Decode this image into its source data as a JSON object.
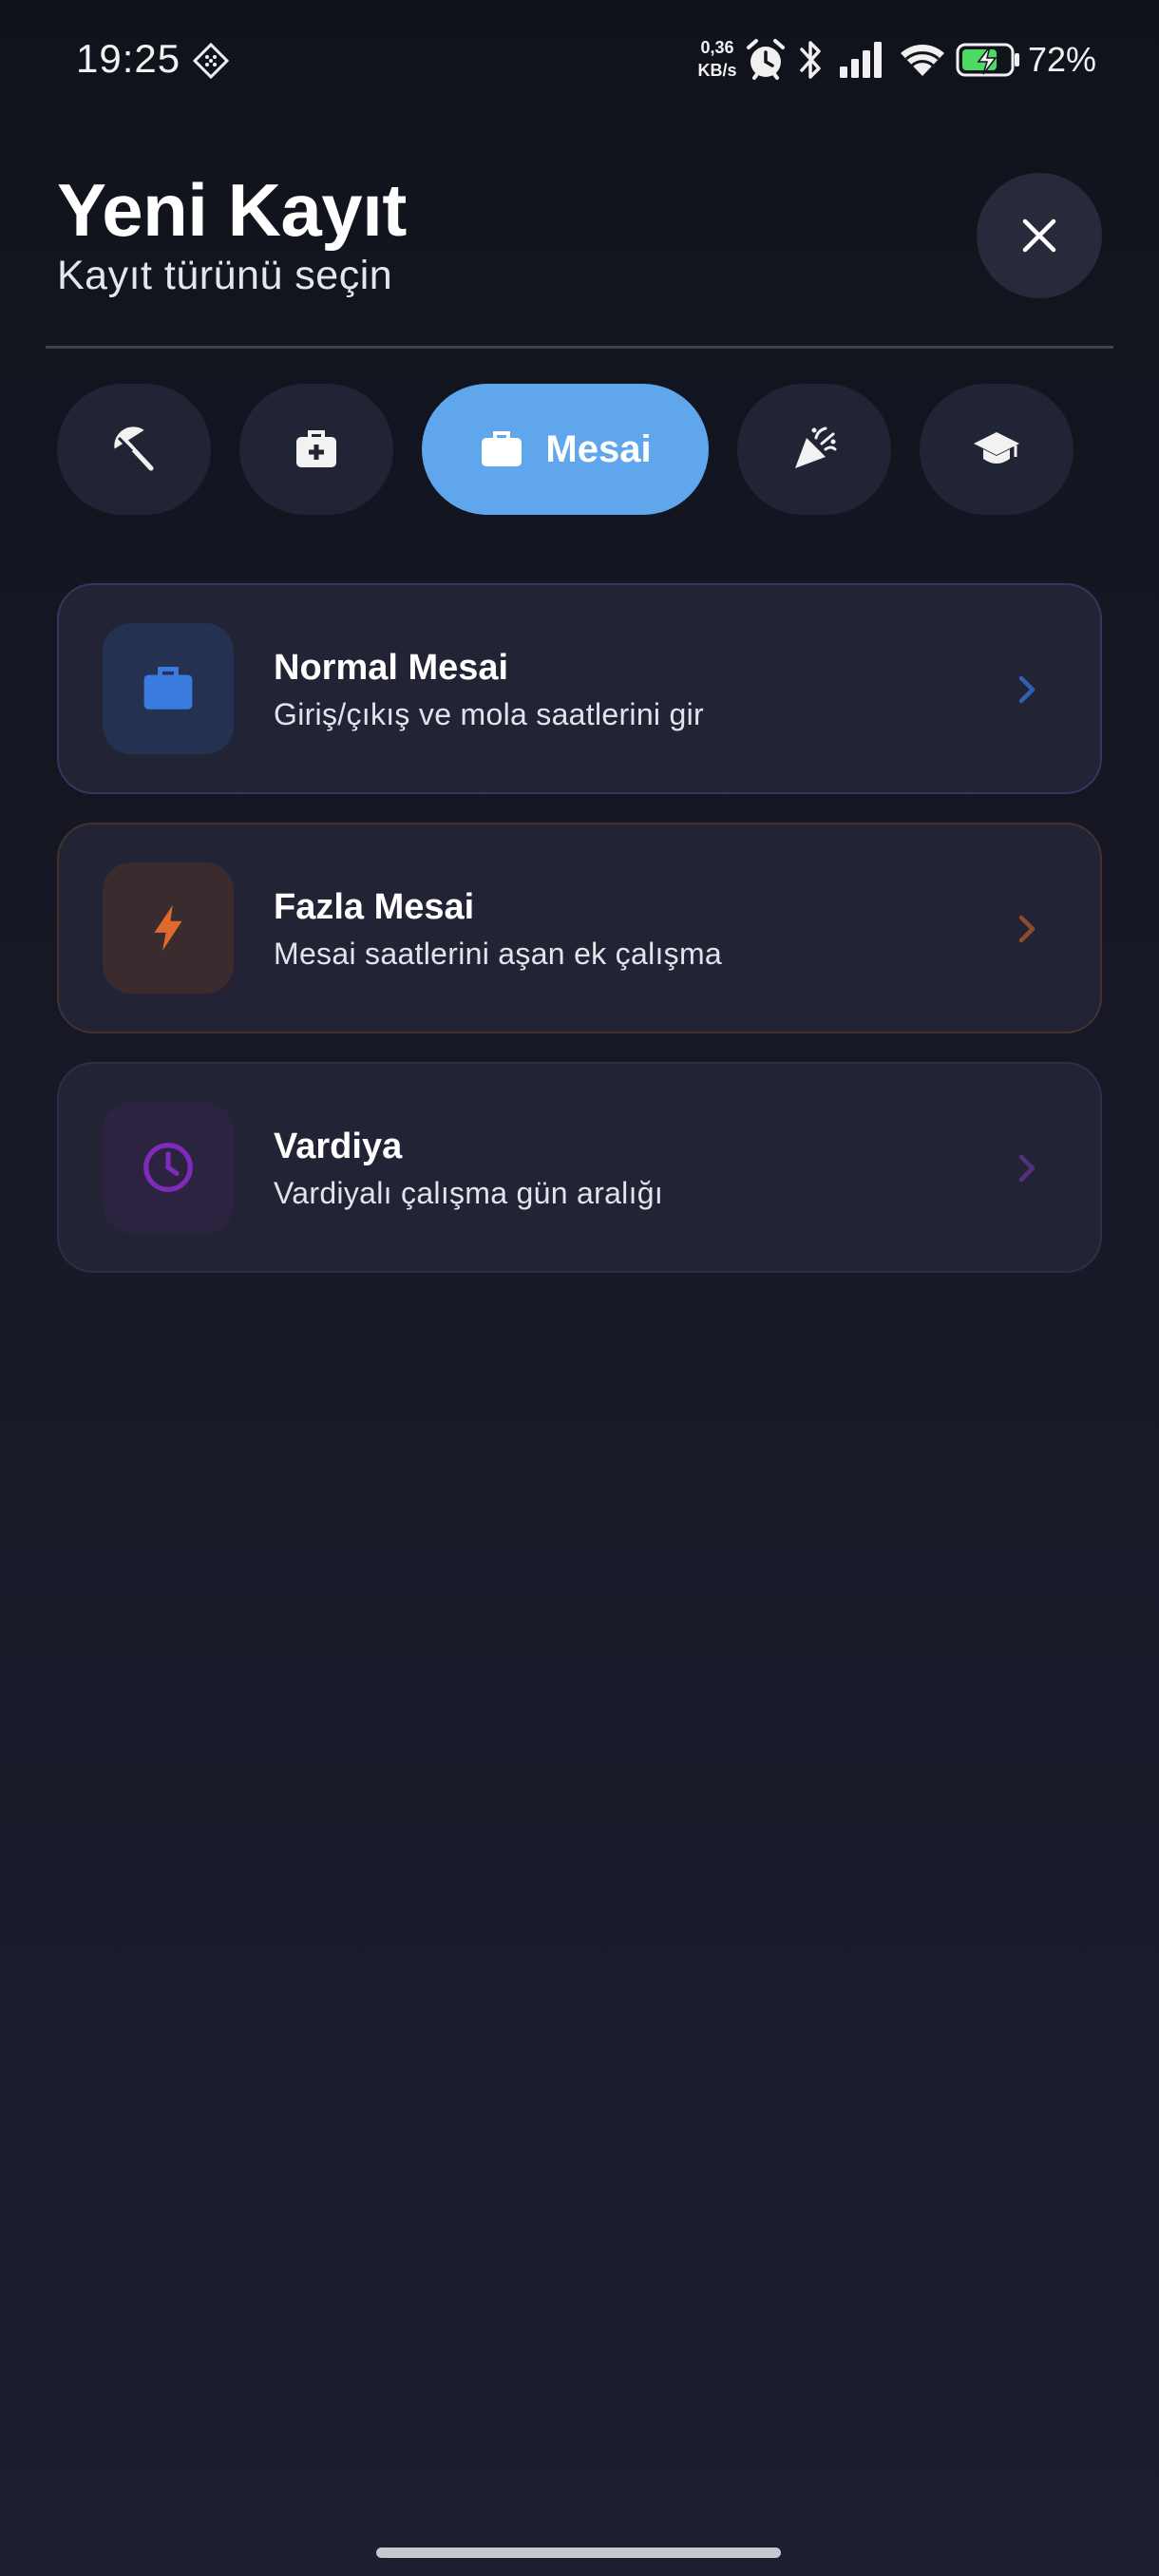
{
  "status_bar": {
    "time": "19:25",
    "network_speed_value": "0,36",
    "network_speed_unit": "KB/s",
    "battery_percent": "72%",
    "icons": [
      "grid-icon",
      "alarm-icon",
      "bluetooth-icon",
      "signal-icon",
      "wifi-icon",
      "battery-charging-icon"
    ]
  },
  "header": {
    "title": "Yeni Kayıt",
    "subtitle": "Kayıt türünü seçin",
    "close_icon": "close-icon"
  },
  "categories": [
    {
      "icon": "beach-umbrella-icon",
      "label": "",
      "active": false
    },
    {
      "icon": "medical-bag-icon",
      "label": "",
      "active": false
    },
    {
      "icon": "briefcase-icon",
      "label": "Mesai",
      "active": true
    },
    {
      "icon": "party-popper-icon",
      "label": "",
      "active": false
    },
    {
      "icon": "graduation-cap-icon",
      "label": "",
      "active": false
    }
  ],
  "options": [
    {
      "title": "Normal Mesai",
      "description": "Giriş/çıkış ve mola saatlerini gir",
      "icon": "briefcase-icon",
      "accent": "#3a7be0"
    },
    {
      "title": "Fazla Mesai",
      "description": "Mesai saatlerini aşan ek çalışma",
      "icon": "bolt-icon",
      "accent": "#e06a2e"
    },
    {
      "title": "Vardiya",
      "description": "Vardiyalı çalışma gün aralığı",
      "icon": "clock-icon",
      "accent": "#7d2bb8"
    }
  ],
  "colors": {
    "active_chip": "#5fa6ec",
    "background": "#161925"
  }
}
